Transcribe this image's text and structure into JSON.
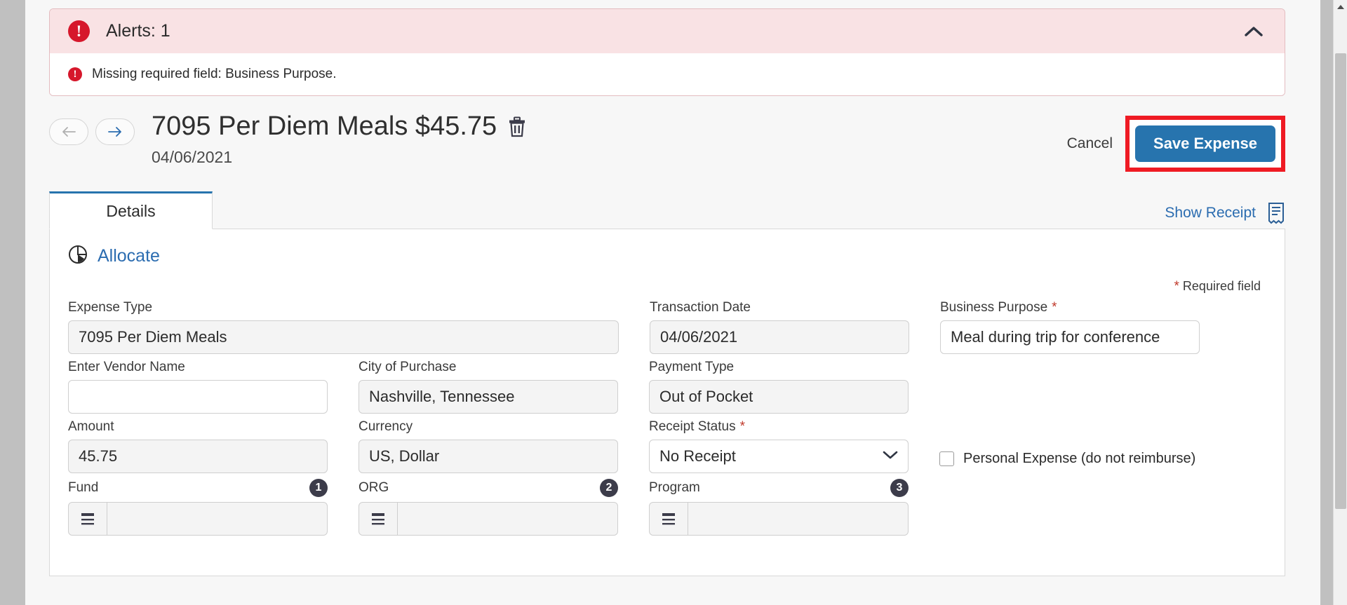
{
  "alert": {
    "title": "Alerts: 1",
    "collapse_icon": "chevron-up-icon",
    "error_icon": "exclamation-circle-icon",
    "messages": [
      "Missing required field: Business Purpose."
    ]
  },
  "header": {
    "back_icon": "arrow-left-icon",
    "forward_icon": "arrow-right-icon",
    "title": "7095 Per Diem Meals $45.75",
    "delete_icon": "trash-icon",
    "date": "04/06/2021",
    "cancel_label": "Cancel",
    "save_label": "Save Expense",
    "highlight_color": "#ef1b24",
    "save_color": "#2774ae"
  },
  "tabs": {
    "items": [
      {
        "label": "Details",
        "active": true
      }
    ],
    "show_receipt_label": "Show Receipt",
    "receipt_icon": "receipt-icon"
  },
  "form": {
    "allocate_label": "Allocate",
    "allocate_icon": "pie-chart-icon",
    "required_note": "Required field",
    "required_star": "*",
    "fields": {
      "expense_type": {
        "label": "Expense Type",
        "value": "7095 Per Diem Meals"
      },
      "transaction_date": {
        "label": "Transaction Date",
        "value": "04/06/2021"
      },
      "business_purpose": {
        "label": "Business Purpose",
        "value": "Meal during trip for conference",
        "required": true
      },
      "vendor_name": {
        "label": "Enter Vendor Name",
        "value": "",
        "placeholder": ""
      },
      "city_of_purchase": {
        "label": "City of Purchase",
        "value": "Nashville, Tennessee"
      },
      "payment_type": {
        "label": "Payment Type",
        "value": "Out of Pocket"
      },
      "amount": {
        "label": "Amount",
        "value": "45.75"
      },
      "currency": {
        "label": "Currency",
        "value": "US, Dollar"
      },
      "receipt_status": {
        "label": "Receipt Status",
        "value": "No Receipt",
        "required": true,
        "chevron": "⌄"
      },
      "personal_expense": {
        "label": "Personal Expense (do not reimburse)",
        "checked": false
      },
      "fund": {
        "label": "Fund",
        "badge": "1",
        "value": ""
      },
      "org": {
        "label": "ORG",
        "badge": "2",
        "value": ""
      },
      "program": {
        "label": "Program",
        "badge": "3",
        "value": ""
      }
    }
  },
  "scrollbar": {
    "up_icon": "triangle-up-icon"
  }
}
